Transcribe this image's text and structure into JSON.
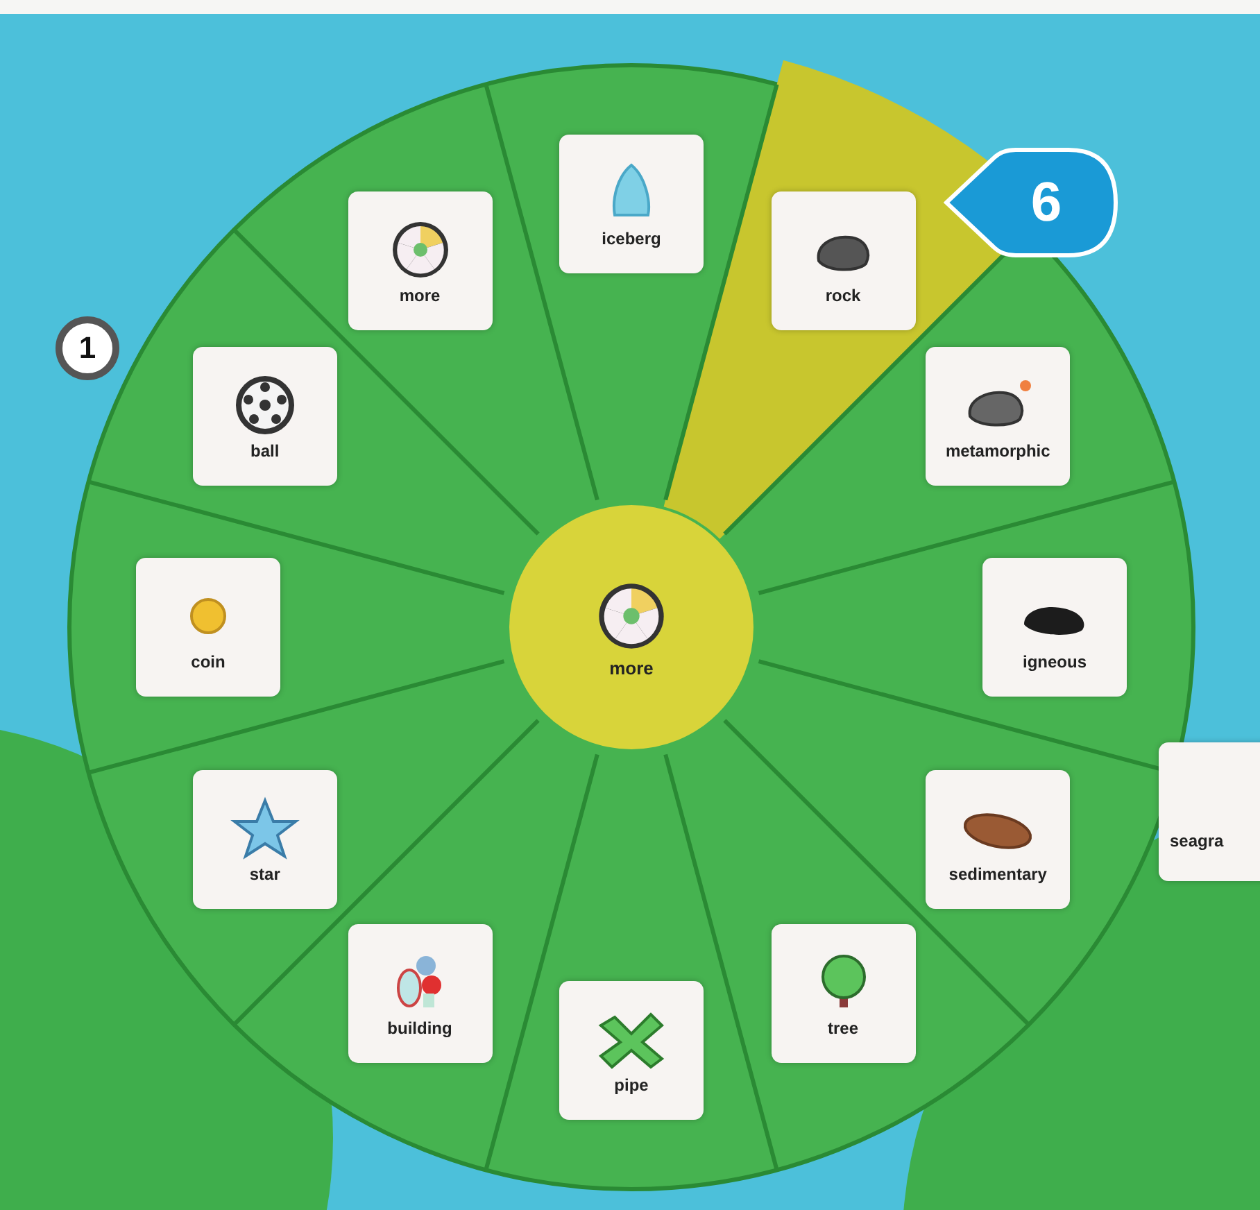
{
  "wheel": {
    "center": {
      "label": "more",
      "selected": true
    },
    "items": [
      {
        "label": "more",
        "selected": false
      },
      {
        "label": "iceberg",
        "selected": false
      },
      {
        "label": "rock",
        "selected": true
      },
      {
        "label": "metamorphic",
        "selected": false
      },
      {
        "label": "igneous",
        "selected": false
      },
      {
        "label": "sedimentary",
        "selected": false
      },
      {
        "label": "tree",
        "selected": false
      },
      {
        "label": "pipe",
        "selected": false
      },
      {
        "label": "building",
        "selected": false
      },
      {
        "label": "star",
        "selected": false
      },
      {
        "label": "coin",
        "selected": false
      },
      {
        "label": "ball",
        "selected": false
      }
    ]
  },
  "callout": {
    "text": "6"
  },
  "side_badge": {
    "text": "1"
  },
  "neighbor_items": [
    {
      "label": "seagra"
    }
  ]
}
